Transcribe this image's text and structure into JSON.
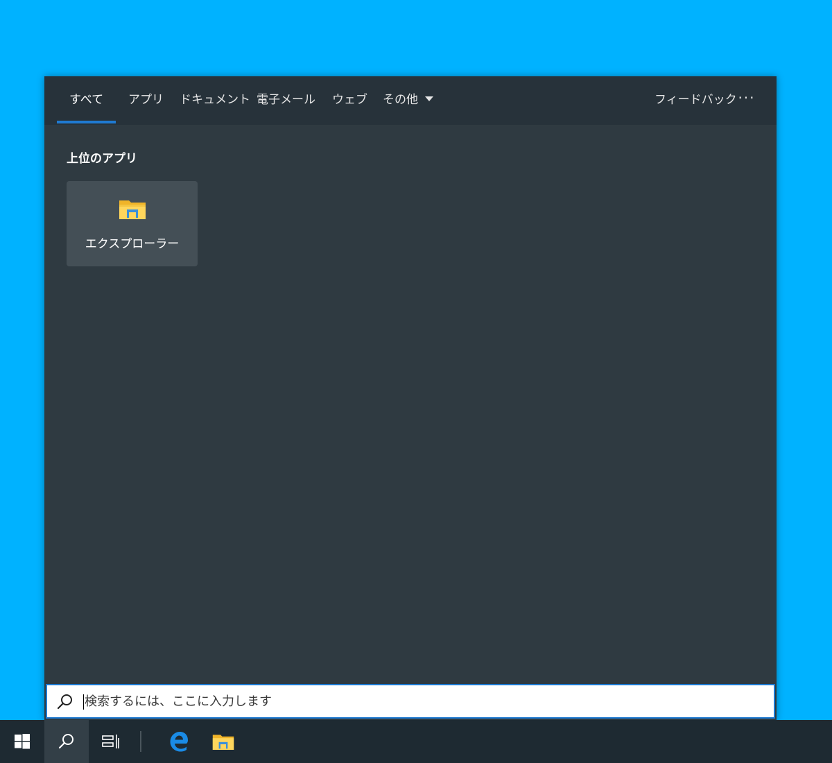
{
  "search_panel": {
    "tabs": [
      {
        "label": "すべて",
        "active": true
      },
      {
        "label": "アプリ"
      },
      {
        "label": "ドキュメント"
      },
      {
        "label": "電子メール"
      },
      {
        "label": "ウェブ"
      },
      {
        "label": "その他"
      }
    ],
    "feedback_label": "フィードバック",
    "more_label": "···",
    "section_title": "上位のアプリ",
    "top_app": {
      "label": "エクスプローラー",
      "icon": "file-explorer-icon"
    }
  },
  "search": {
    "placeholder": "検索するには、ここに入力します",
    "value": ""
  },
  "taskbar": {
    "items": [
      {
        "icon": "windows-start-icon"
      },
      {
        "icon": "search-icon",
        "active": true
      },
      {
        "icon": "task-view-icon"
      },
      {
        "icon": "edge-browser-icon"
      },
      {
        "icon": "file-explorer-icon"
      }
    ]
  },
  "colors": {
    "desktop": "#00b2ff",
    "panel": "#2f3a41",
    "topbar": "#27323a",
    "accent": "#1f7ad1",
    "tile": "#444f56",
    "taskbar": "#1e2a32"
  }
}
